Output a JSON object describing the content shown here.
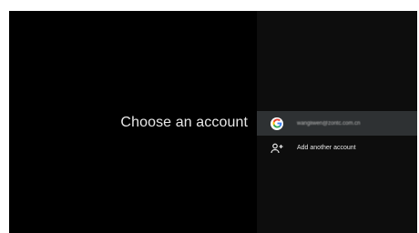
{
  "title": "Choose an account",
  "accounts": [
    {
      "label": "wangliwen@zontc.com.cn",
      "icon": "google-logo-icon",
      "selected": true
    },
    {
      "label": "Add another account",
      "icon": "add-person-icon",
      "selected": false
    }
  ],
  "colors": {
    "background": "#000000",
    "right_pane": "#0d0d0d",
    "selected_row": "#2e3133",
    "text": "#e6e6e6"
  }
}
